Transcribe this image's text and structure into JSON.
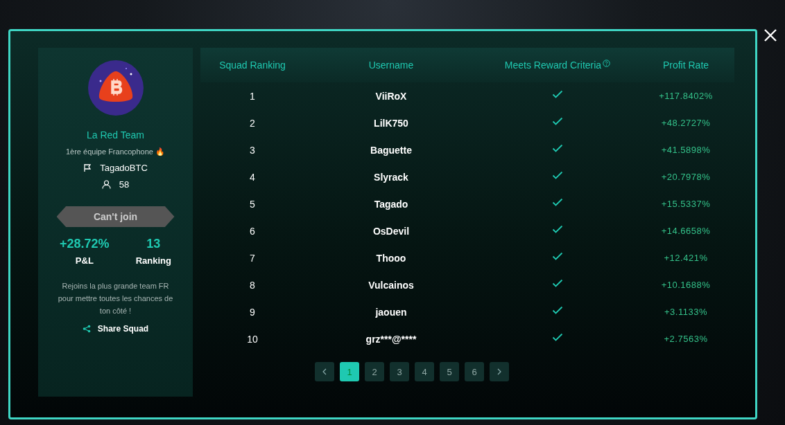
{
  "squad": {
    "name": "La Red Team",
    "tagline": "1ère équipe Francophone 🔥",
    "leader": "TagadoBTC",
    "members": "58",
    "join_button": {
      "label": "Can't join",
      "disabled": true
    },
    "stats": [
      {
        "value": "+28.72%",
        "label": "P&L"
      },
      {
        "value": "13",
        "label": "Ranking"
      }
    ],
    "description": "Rejoins la plus grande team FR pour mettre toutes les chances de ton côté !",
    "share": "Share Squad"
  },
  "table": {
    "columns": [
      "Squad Ranking",
      "Username",
      "Meets Reward Criteria",
      "Profit Rate"
    ],
    "rows": [
      {
        "rank": "1",
        "username": "ViiRoX",
        "meets": true,
        "profit": "+117.8402%"
      },
      {
        "rank": "2",
        "username": "LilK750",
        "meets": true,
        "profit": "+48.2727%"
      },
      {
        "rank": "3",
        "username": "Baguette",
        "meets": true,
        "profit": "+41.5898%"
      },
      {
        "rank": "4",
        "username": "Slyrack",
        "meets": true,
        "profit": "+20.7978%"
      },
      {
        "rank": "5",
        "username": "Tagado",
        "meets": true,
        "profit": "+15.5337%"
      },
      {
        "rank": "6",
        "username": "OsDevil",
        "meets": true,
        "profit": "+14.6658%"
      },
      {
        "rank": "7",
        "username": "Thooo",
        "meets": true,
        "profit": "+12.421%"
      },
      {
        "rank": "8",
        "username": "Vulcainos",
        "meets": true,
        "profit": "+10.1688%"
      },
      {
        "rank": "9",
        "username": "jaouen",
        "meets": true,
        "profit": "+3.1133%"
      },
      {
        "rank": "10",
        "username": "grz***@****",
        "meets": true,
        "profit": "+2.7563%"
      }
    ]
  },
  "pagination": {
    "pages": [
      {
        "label": "1",
        "selected": true
      },
      {
        "label": "2",
        "selected": false
      },
      {
        "label": "3",
        "selected": false
      },
      {
        "label": "4",
        "selected": false
      },
      {
        "label": "5",
        "selected": false
      },
      {
        "label": "6",
        "selected": false
      }
    ]
  }
}
